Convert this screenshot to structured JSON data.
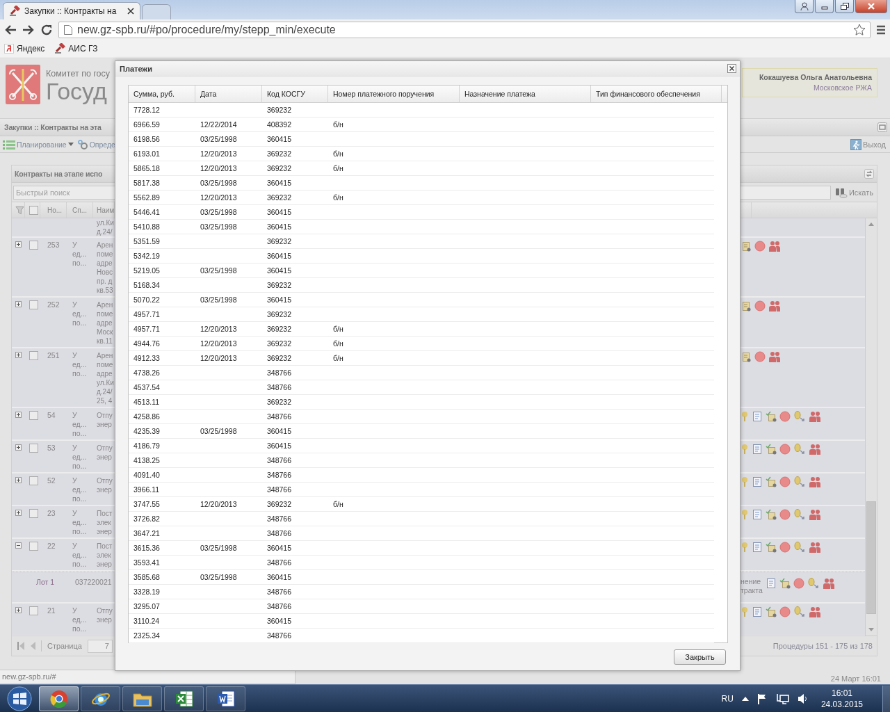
{
  "browser": {
    "tabs": [
      {
        "title": "Закупки :: Контракты на",
        "selected": true
      },
      {
        "selected": false
      }
    ],
    "url": "new.gz-spb.ru/#po/procedure/my/stepp_min/execute",
    "bookmarks": [
      "Яндекс",
      "АИС ГЗ"
    ]
  },
  "app": {
    "header": {
      "org_line1": "Комитет по госу",
      "org_line2": "Госуд",
      "user_name": "Кокашуева Ольга Анатольевна",
      "user_org": "Московское РЖА"
    },
    "title_bar": "Закупки :: Контракты на эта",
    "menu": [
      {
        "label": "Планирование",
        "dropdown": true
      },
      {
        "label": "Опреде"
      }
    ],
    "logout": "Выход",
    "panel": {
      "title": "Контракты на этапе испо",
      "select_all": {
        "checked": false
      },
      "search": {
        "placeholder": "Быстрый поиск"
      },
      "search_button": "Искать",
      "columns": [
        "Но...",
        "Сп...",
        "Наим"
      ],
      "rows": [
        {
          "kind": "partial",
          "name": [
            "ул.Ки",
            "д.24/"
          ]
        },
        {
          "kind": "lease",
          "expanded": false,
          "checked": false,
          "number": "253",
          "method": [
            "У",
            "ед...",
            "по..."
          ],
          "name": [
            "Арен",
            "поме",
            "адре",
            "Новс",
            "пр. д",
            "кв.53"
          ]
        },
        {
          "kind": "lease",
          "expanded": false,
          "checked": false,
          "number": "252",
          "method": [
            "У",
            "ед...",
            "по..."
          ],
          "name": [
            "Арен",
            "поме",
            "адре",
            "Моск",
            "кв.11"
          ]
        },
        {
          "kind": "lease",
          "expanded": false,
          "checked": false,
          "number": "251",
          "method": [
            "У",
            "ед...",
            "по..."
          ],
          "name": [
            "Арен",
            "поме",
            "адре",
            "ул.Ки",
            "д.24/",
            "25, 4"
          ]
        },
        {
          "kind": "supply",
          "expanded": false,
          "checked": false,
          "number": "54",
          "method": [
            "У",
            "ед...",
            "по..."
          ],
          "name": [
            "Отпу",
            "энер"
          ]
        },
        {
          "kind": "supply",
          "expanded": false,
          "checked": false,
          "number": "53",
          "method": [
            "У",
            "ед...",
            "по..."
          ],
          "name": [
            "Отпу",
            "энер"
          ]
        },
        {
          "kind": "supply",
          "expanded": false,
          "checked": false,
          "number": "52",
          "method": [
            "У",
            "ед...",
            "по..."
          ],
          "name": [
            "Отпу",
            "энер"
          ]
        },
        {
          "kind": "supply",
          "expanded": false,
          "checked": false,
          "number": "23",
          "method": [
            "У",
            "ед...",
            "по..."
          ],
          "name": [
            "Пост",
            "элек",
            "энер"
          ]
        },
        {
          "kind": "supply",
          "expanded": true,
          "checked": false,
          "number": "22",
          "method": [
            "У",
            "ед...",
            "по..."
          ],
          "name": [
            "Пост",
            "элек",
            "энер"
          ]
        },
        {
          "kind": "lot",
          "label": "Лот 1",
          "code": "037220021",
          "status": [
            "нение",
            "тракта"
          ]
        },
        {
          "kind": "supply",
          "expanded": false,
          "checked": false,
          "number": "21",
          "method": [
            "У",
            "ед...",
            "по..."
          ],
          "name": [
            "Отпу",
            "энер"
          ]
        }
      ],
      "pager": {
        "label": "Страница",
        "page": "7",
        "summary": "Процедуры 151 - 175 из 178"
      }
    }
  },
  "dialog": {
    "title": "Платежи",
    "columns": [
      "Сумма, руб.",
      "Дата",
      "Код КОСГУ",
      "Номер платежного поручения",
      "Назначение платежа",
      "Тип финансового обеспечения"
    ],
    "rows": [
      {
        "sum": "7728.12",
        "kosgu": "369232"
      },
      {
        "sum": "6966.59",
        "date": "12/22/2014",
        "kosgu": "408392",
        "order": "б/н"
      },
      {
        "sum": "6198.56",
        "date": "03/25/1998",
        "kosgu": "360415"
      },
      {
        "sum": "6193.01",
        "date": "12/20/2013",
        "kosgu": "369232",
        "order": "б/н"
      },
      {
        "sum": "5865.18",
        "date": "12/20/2013",
        "kosgu": "369232",
        "order": "б/н"
      },
      {
        "sum": "5817.38",
        "date": "03/25/1998",
        "kosgu": "360415"
      },
      {
        "sum": "5562.89",
        "date": "12/20/2013",
        "kosgu": "369232",
        "order": "б/н"
      },
      {
        "sum": "5446.41",
        "date": "03/25/1998",
        "kosgu": "360415"
      },
      {
        "sum": "5410.88",
        "date": "03/25/1998",
        "kosgu": "360415"
      },
      {
        "sum": "5351.59",
        "kosgu": "369232"
      },
      {
        "sum": "5342.19",
        "kosgu": "360415"
      },
      {
        "sum": "5219.05",
        "date": "03/25/1998",
        "kosgu": "360415"
      },
      {
        "sum": "5168.34",
        "kosgu": "369232"
      },
      {
        "sum": "5070.22",
        "date": "03/25/1998",
        "kosgu": "360415"
      },
      {
        "sum": "4957.71",
        "kosgu": "369232"
      },
      {
        "sum": "4957.71",
        "date": "12/20/2013",
        "kosgu": "369232",
        "order": "б/н"
      },
      {
        "sum": "4944.76",
        "date": "12/20/2013",
        "kosgu": "369232",
        "order": "б/н"
      },
      {
        "sum": "4912.33",
        "date": "12/20/2013",
        "kosgu": "369232",
        "order": "б/н"
      },
      {
        "sum": "4738.26",
        "kosgu": "348766"
      },
      {
        "sum": "4537.54",
        "kosgu": "348766"
      },
      {
        "sum": "4513.11",
        "kosgu": "369232"
      },
      {
        "sum": "4258.86",
        "kosgu": "348766"
      },
      {
        "sum": "4235.39",
        "date": "03/25/1998",
        "kosgu": "360415"
      },
      {
        "sum": "4186.79",
        "kosgu": "360415"
      },
      {
        "sum": "4138.25",
        "kosgu": "348766"
      },
      {
        "sum": "4091.40",
        "kosgu": "348766"
      },
      {
        "sum": "3966.11",
        "kosgu": "348766"
      },
      {
        "sum": "3747.55",
        "date": "12/20/2013",
        "kosgu": "369232",
        "order": "б/н"
      },
      {
        "sum": "3726.82",
        "kosgu": "348766"
      },
      {
        "sum": "3647.21",
        "kosgu": "348766"
      },
      {
        "sum": "3615.36",
        "date": "03/25/1998",
        "kosgu": "360415"
      },
      {
        "sum": "3593.41",
        "kosgu": "348766"
      },
      {
        "sum": "3585.68",
        "date": "03/25/1998",
        "kosgu": "360415"
      },
      {
        "sum": "3328.19",
        "kosgu": "348766"
      },
      {
        "sum": "3295.07",
        "kosgu": "348766"
      },
      {
        "sum": "3110.24",
        "kosgu": "360415"
      },
      {
        "sum": "2325.34",
        "kosgu": "348766"
      }
    ],
    "close_button": "Закрыть"
  },
  "status": {
    "url": "new.gz-spb.ru/#",
    "datetime": "24 Март 16:01"
  },
  "taskbar": {
    "apps": [
      {
        "selected": true
      },
      {
        "selected": false
      },
      {
        "selected": false
      },
      {
        "selected": false
      },
      {
        "selected": false
      }
    ],
    "language": "RU",
    "time": "16:01",
    "date": "24.03.2015"
  }
}
